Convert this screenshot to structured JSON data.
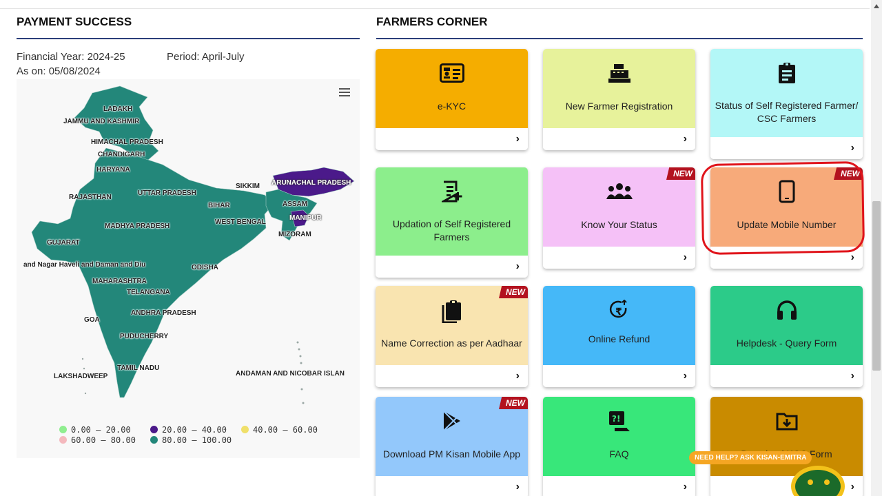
{
  "left": {
    "title": "PAYMENT SUCCESS",
    "financial_year": "Financial Year: 2024-25",
    "period": "Period: April-July",
    "as_on": "As on: 05/08/2024",
    "menu_icon": "hamburger-icon",
    "state_labels": [
      "LADAKH",
      "JAMMU AND KASHMIR",
      "HIMACHAL PRADESH",
      "CHANDIGARH",
      "HARYANA",
      "RAJASTHAN",
      "UTTAR PRADESH",
      "SIKKIM",
      "ARUNACHAL PRADESH",
      "BIHAR",
      "ASSAM",
      "WEST BENGAL",
      "MANIPUR",
      "MADHYA PRADESH",
      "MIZORAM",
      "GUJARAT",
      "and Nagar Haveli and Daman and Diu",
      "ODISHA",
      "MAHARASHTRA",
      "TELANGANA",
      "ANDHRA PRADESH",
      "GOA",
      "PUDUCHERRY",
      "TAMIL NADU",
      "LAKSHADWEEP",
      "ANDAMAN AND NICOBAR ISLAN"
    ],
    "legend": [
      {
        "label": "0.00 – 20.00",
        "color": "#90ee90"
      },
      {
        "label": "20.00 – 40.00",
        "color": "#4b1a8a"
      },
      {
        "label": "40.00 – 60.00",
        "color": "#f0e06a"
      },
      {
        "label": "60.00 – 80.00",
        "color": "#f4b8bd"
      },
      {
        "label": "80.00 – 100.00",
        "color": "#23877a"
      }
    ]
  },
  "right": {
    "title": "FARMERS CORNER",
    "cards": [
      {
        "label": "e-KYC",
        "color": "#f5ad00",
        "icon": "id-card-icon",
        "new": ""
      },
      {
        "label": "New Farmer Registration",
        "color": "#e7f29b",
        "icon": "cash-register-icon",
        "new": ""
      },
      {
        "label": "Status of Self Registered Farmer/ CSC Farmers",
        "color": "#b3f7f7",
        "icon": "clipboard-list-icon",
        "new": ""
      },
      {
        "label": "Updation of Self Registered Farmers",
        "color": "#8cee8c",
        "icon": "edit-document-icon",
        "new": ""
      },
      {
        "label": "Know Your Status",
        "color": "#f5c1f7",
        "icon": "users-icon",
        "new": "NEW"
      },
      {
        "label": "Update Mobile Number",
        "color": "#f7aa7a",
        "icon": "mobile-phone-icon",
        "new": "NEW"
      },
      {
        "label": "Name Correction as per Aadhaar",
        "color": "#f9e4b0",
        "icon": "clipboard-copy-icon",
        "new": "NEW"
      },
      {
        "label": "Online Refund",
        "color": "#45b8f8",
        "icon": "rupee-refund-icon",
        "new": ""
      },
      {
        "label": "Helpdesk - Query Form",
        "color": "#2ccb89",
        "icon": "headphones-icon",
        "new": ""
      },
      {
        "label": "Download PM Kisan Mobile App",
        "color": "#93c8fb",
        "icon": "play-store-icon",
        "new": "NEW"
      },
      {
        "label": "FAQ",
        "color": "#38e77a",
        "icon": "faq-chat-icon",
        "new": ""
      },
      {
        "label": "Download KCC Form",
        "color": "#c98b00",
        "icon": "folder-download-icon",
        "new": ""
      }
    ],
    "chevron": "›"
  },
  "assistant": {
    "pill": "NEED HELP? ASK KISAN-EMITRA",
    "icon": "chatbot-icon"
  }
}
